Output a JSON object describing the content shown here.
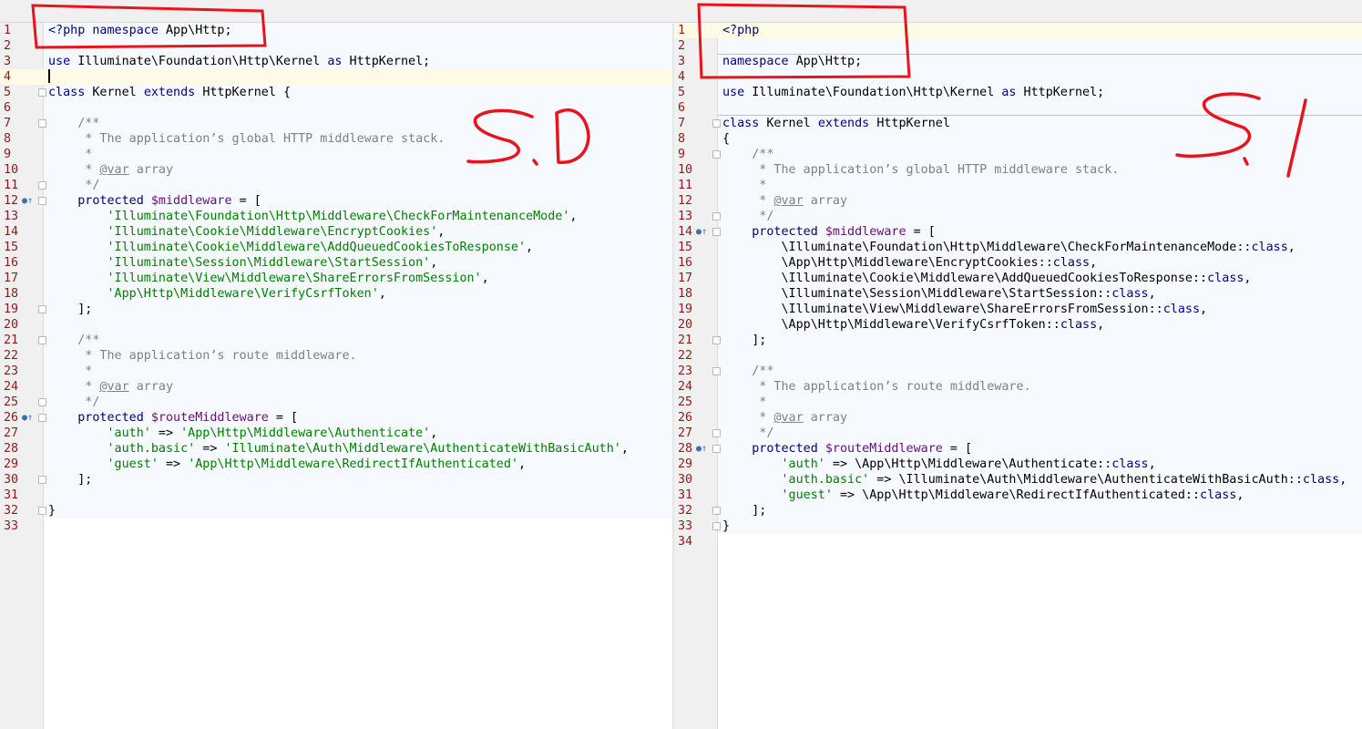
{
  "left_pane": {
    "version_annotation": "5.0",
    "lines": [
      {
        "n": "1",
        "tokens": [
          [
            "<?php ",
            "kw"
          ],
          [
            "namespace ",
            "kw"
          ],
          [
            "App\\Http;",
            ""
          ]
        ]
      },
      {
        "n": "2",
        "tokens": []
      },
      {
        "n": "3",
        "tokens": [
          [
            "use ",
            "kw"
          ],
          [
            "Illuminate\\Foundation\\Http\\Kernel ",
            ""
          ],
          [
            "as ",
            "kw"
          ],
          [
            "HttpKernel;",
            ""
          ]
        ]
      },
      {
        "n": "4",
        "tokens": [],
        "current": true
      },
      {
        "n": "5",
        "tokens": [
          [
            "class ",
            "kw"
          ],
          [
            "Kernel ",
            ""
          ],
          [
            "extends ",
            "kw"
          ],
          [
            "HttpKernel {",
            ""
          ]
        ]
      },
      {
        "n": "6",
        "tokens": []
      },
      {
        "n": "7",
        "tokens": [
          [
            "    /**",
            "cmt"
          ]
        ]
      },
      {
        "n": "8",
        "tokens": [
          [
            "     * The application’s global HTTP middleware stack.",
            "cmt"
          ]
        ]
      },
      {
        "n": "9",
        "tokens": [
          [
            "     *",
            "cmt"
          ]
        ]
      },
      {
        "n": "10",
        "tokens": [
          [
            "     * ",
            "cmt"
          ],
          [
            "@var",
            "tag"
          ],
          [
            " array",
            "cmt"
          ]
        ]
      },
      {
        "n": "11",
        "tokens": [
          [
            "     */",
            "cmt"
          ]
        ]
      },
      {
        "n": "12",
        "tokens": [
          [
            "    protected ",
            "kw"
          ],
          [
            "$middleware",
            "var"
          ],
          [
            " = [",
            ""
          ]
        ]
      },
      {
        "n": "13",
        "tokens": [
          [
            "        ",
            ""
          ],
          [
            "'Illuminate\\Foundation\\Http\\Middleware\\CheckForMaintenanceMode'",
            "str"
          ],
          [
            ",",
            ""
          ]
        ]
      },
      {
        "n": "14",
        "tokens": [
          [
            "        ",
            ""
          ],
          [
            "'Illuminate\\Cookie\\Middleware\\EncryptCookies'",
            "str"
          ],
          [
            ",",
            ""
          ]
        ]
      },
      {
        "n": "15",
        "tokens": [
          [
            "        ",
            ""
          ],
          [
            "'Illuminate\\Cookie\\Middleware\\AddQueuedCookiesToResponse'",
            "str"
          ],
          [
            ",",
            ""
          ]
        ]
      },
      {
        "n": "16",
        "tokens": [
          [
            "        ",
            ""
          ],
          [
            "'Illuminate\\Session\\Middleware\\StartSession'",
            "str"
          ],
          [
            ",",
            ""
          ]
        ]
      },
      {
        "n": "17",
        "tokens": [
          [
            "        ",
            ""
          ],
          [
            "'Illuminate\\View\\Middleware\\ShareErrorsFromSession'",
            "str"
          ],
          [
            ",",
            ""
          ]
        ]
      },
      {
        "n": "18",
        "tokens": [
          [
            "        ",
            ""
          ],
          [
            "'App\\Http\\Middleware\\VerifyCsrfToken'",
            "str"
          ],
          [
            ",",
            ""
          ]
        ]
      },
      {
        "n": "19",
        "tokens": [
          [
            "    ];",
            ""
          ]
        ]
      },
      {
        "n": "20",
        "tokens": []
      },
      {
        "n": "21",
        "tokens": [
          [
            "    /**",
            "cmt"
          ]
        ]
      },
      {
        "n": "22",
        "tokens": [
          [
            "     * The application’s route middleware.",
            "cmt"
          ]
        ]
      },
      {
        "n": "23",
        "tokens": [
          [
            "     *",
            "cmt"
          ]
        ]
      },
      {
        "n": "24",
        "tokens": [
          [
            "     * ",
            "cmt"
          ],
          [
            "@var",
            "tag"
          ],
          [
            " array",
            "cmt"
          ]
        ]
      },
      {
        "n": "25",
        "tokens": [
          [
            "     */",
            "cmt"
          ]
        ]
      },
      {
        "n": "26",
        "tokens": [
          [
            "    protected ",
            "kw"
          ],
          [
            "$routeMiddleware",
            "var"
          ],
          [
            " = [",
            ""
          ]
        ]
      },
      {
        "n": "27",
        "tokens": [
          [
            "        ",
            ""
          ],
          [
            "'auth'",
            "str"
          ],
          [
            " => ",
            ""
          ],
          [
            "'App\\Http\\Middleware\\Authenticate'",
            "str"
          ],
          [
            ",",
            ""
          ]
        ]
      },
      {
        "n": "28",
        "tokens": [
          [
            "        ",
            ""
          ],
          [
            "'auth.basic'",
            "str"
          ],
          [
            " => ",
            ""
          ],
          [
            "'Illuminate\\Auth\\Middleware\\AuthenticateWithBasicAuth'",
            "str"
          ],
          [
            ",",
            ""
          ]
        ]
      },
      {
        "n": "29",
        "tokens": [
          [
            "        ",
            ""
          ],
          [
            "'guest'",
            "str"
          ],
          [
            " => ",
            ""
          ],
          [
            "'App\\Http\\Middleware\\RedirectIfAuthenticated'",
            "str"
          ],
          [
            ",",
            ""
          ]
        ]
      },
      {
        "n": "30",
        "tokens": [
          [
            "    ];",
            ""
          ]
        ]
      },
      {
        "n": "31",
        "tokens": []
      },
      {
        "n": "32",
        "tokens": [
          [
            "}",
            ""
          ]
        ]
      },
      {
        "n": "33",
        "tokens": []
      }
    ]
  },
  "right_pane": {
    "version_annotation": "5.1",
    "lines": [
      {
        "n": "1",
        "tokens": [
          [
            "<?php",
            "kw"
          ]
        ],
        "current": true
      },
      {
        "n": "2",
        "tokens": []
      },
      {
        "n": "3",
        "tokens": [
          [
            "namespace ",
            "kw"
          ],
          [
            "App\\Http;",
            ""
          ]
        ]
      },
      {
        "n": "4",
        "tokens": []
      },
      {
        "n": "5",
        "tokens": [
          [
            "use ",
            "kw"
          ],
          [
            "Illuminate\\Foundation\\Http\\Kernel ",
            ""
          ],
          [
            "as ",
            "kw"
          ],
          [
            "HttpKernel;",
            ""
          ]
        ]
      },
      {
        "n": "6",
        "tokens": []
      },
      {
        "n": "7",
        "tokens": [
          [
            "class ",
            "kw"
          ],
          [
            "Kernel ",
            ""
          ],
          [
            "extends ",
            "kw"
          ],
          [
            "HttpKernel",
            ""
          ]
        ]
      },
      {
        "n": "8",
        "tokens": [
          [
            "{",
            ""
          ]
        ]
      },
      {
        "n": "9",
        "tokens": [
          [
            "    /**",
            "cmt"
          ]
        ]
      },
      {
        "n": "10",
        "tokens": [
          [
            "     * The application’s global HTTP middleware stack.",
            "cmt"
          ]
        ]
      },
      {
        "n": "11",
        "tokens": [
          [
            "     *",
            "cmt"
          ]
        ]
      },
      {
        "n": "12",
        "tokens": [
          [
            "     * ",
            "cmt"
          ],
          [
            "@var",
            "tag"
          ],
          [
            " array",
            "cmt"
          ]
        ]
      },
      {
        "n": "13",
        "tokens": [
          [
            "     */",
            "cmt"
          ]
        ]
      },
      {
        "n": "14",
        "tokens": [
          [
            "    protected ",
            "kw"
          ],
          [
            "$middleware",
            "var"
          ],
          [
            " = [",
            ""
          ]
        ]
      },
      {
        "n": "15",
        "tokens": [
          [
            "        \\Illuminate\\Foundation\\Http\\Middleware\\CheckForMaintenanceMode::",
            ""
          ],
          [
            "class",
            "kw"
          ],
          [
            ",",
            ""
          ]
        ]
      },
      {
        "n": "16",
        "tokens": [
          [
            "        \\App\\Http\\Middleware\\EncryptCookies::",
            ""
          ],
          [
            "class",
            "kw"
          ],
          [
            ",",
            ""
          ]
        ]
      },
      {
        "n": "17",
        "tokens": [
          [
            "        \\Illuminate\\Cookie\\Middleware\\AddQueuedCookiesToResponse::",
            ""
          ],
          [
            "class",
            "kw"
          ],
          [
            ",",
            ""
          ]
        ]
      },
      {
        "n": "18",
        "tokens": [
          [
            "        \\Illuminate\\Session\\Middleware\\StartSession::",
            ""
          ],
          [
            "class",
            "kw"
          ],
          [
            ",",
            ""
          ]
        ]
      },
      {
        "n": "19",
        "tokens": [
          [
            "        \\Illuminate\\View\\Middleware\\ShareErrorsFromSession::",
            ""
          ],
          [
            "class",
            "kw"
          ],
          [
            ",",
            ""
          ]
        ]
      },
      {
        "n": "20",
        "tokens": [
          [
            "        \\App\\Http\\Middleware\\VerifyCsrfToken::",
            ""
          ],
          [
            "class",
            "kw"
          ],
          [
            ",",
            ""
          ]
        ]
      },
      {
        "n": "21",
        "tokens": [
          [
            "    ];",
            ""
          ]
        ]
      },
      {
        "n": "22",
        "tokens": []
      },
      {
        "n": "23",
        "tokens": [
          [
            "    /**",
            "cmt"
          ]
        ]
      },
      {
        "n": "24",
        "tokens": [
          [
            "     * The application’s route middleware.",
            "cmt"
          ]
        ]
      },
      {
        "n": "25",
        "tokens": [
          [
            "     *",
            "cmt"
          ]
        ]
      },
      {
        "n": "26",
        "tokens": [
          [
            "     * ",
            "cmt"
          ],
          [
            "@var",
            "tag"
          ],
          [
            " array",
            "cmt"
          ]
        ]
      },
      {
        "n": "27",
        "tokens": [
          [
            "     */",
            "cmt"
          ]
        ]
      },
      {
        "n": "28",
        "tokens": [
          [
            "    protected ",
            "kw"
          ],
          [
            "$routeMiddleware",
            "var"
          ],
          [
            " = [",
            ""
          ]
        ]
      },
      {
        "n": "29",
        "tokens": [
          [
            "        ",
            ""
          ],
          [
            "'auth'",
            "str"
          ],
          [
            " => \\App\\Http\\Middleware\\Authenticate::",
            ""
          ],
          [
            "class",
            "kw"
          ],
          [
            ",",
            ""
          ]
        ]
      },
      {
        "n": "30",
        "tokens": [
          [
            "        ",
            ""
          ],
          [
            "'auth.basic'",
            "str"
          ],
          [
            " => \\Illuminate\\Auth\\Middleware\\AuthenticateWithBasicAuth::",
            ""
          ],
          [
            "class",
            "kw"
          ],
          [
            ",",
            ""
          ]
        ]
      },
      {
        "n": "31",
        "tokens": [
          [
            "        ",
            ""
          ],
          [
            "'guest'",
            "str"
          ],
          [
            " => \\App\\Http\\Middleware\\RedirectIfAuthenticated::",
            ""
          ],
          [
            "class",
            "kw"
          ],
          [
            ",",
            ""
          ]
        ]
      },
      {
        "n": "32",
        "tokens": [
          [
            "    ];",
            ""
          ]
        ]
      },
      {
        "n": "33",
        "tokens": [
          [
            "}",
            ""
          ]
        ]
      },
      {
        "n": "34",
        "tokens": []
      }
    ]
  },
  "colors": {
    "keyword": "#000080",
    "string": "#008000",
    "variable": "#660e7a",
    "comment": "#808080",
    "line_number": "#8c1c1c",
    "annotation_red": "#e8141c",
    "code_background": "#f6f9fd",
    "current_line": "#fdfae5"
  }
}
